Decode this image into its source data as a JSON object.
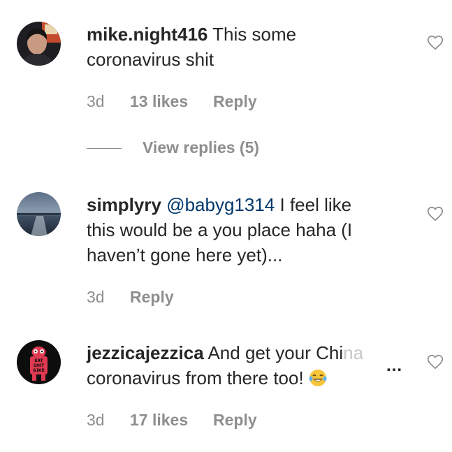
{
  "comments": [
    {
      "username": "mike.night416",
      "text_line1": "This some",
      "text_line2": "coronavirus shit",
      "time": "3d",
      "likes": "13 likes",
      "reply_label": "Reply"
    },
    {
      "username": "simplyry",
      "mention": "@babyg1314",
      "text_line1": "I feel like",
      "text_line2": "this would be a you place haha (I",
      "text_line3": "haven’t gone here yet)...",
      "time": "3d",
      "reply_label": "Reply"
    },
    {
      "username": "jezzicajezzica",
      "text_line1": "And get your Chi",
      "text_fade": "na",
      "text_line2": "coronavirus from there too!",
      "more_label": "...",
      "time": "3d",
      "likes": "17 likes",
      "reply_label": "Reply"
    }
  ],
  "view_replies_label": "View replies (5)",
  "icons": {
    "like": "heart-outline-icon",
    "emoji": "laughing-tears-emoji",
    "avatar_badge_text": "EAT SHIT & DIE"
  },
  "colors": {
    "text": "#262626",
    "secondary": "#8e8e8e",
    "mention": "#00376b"
  }
}
